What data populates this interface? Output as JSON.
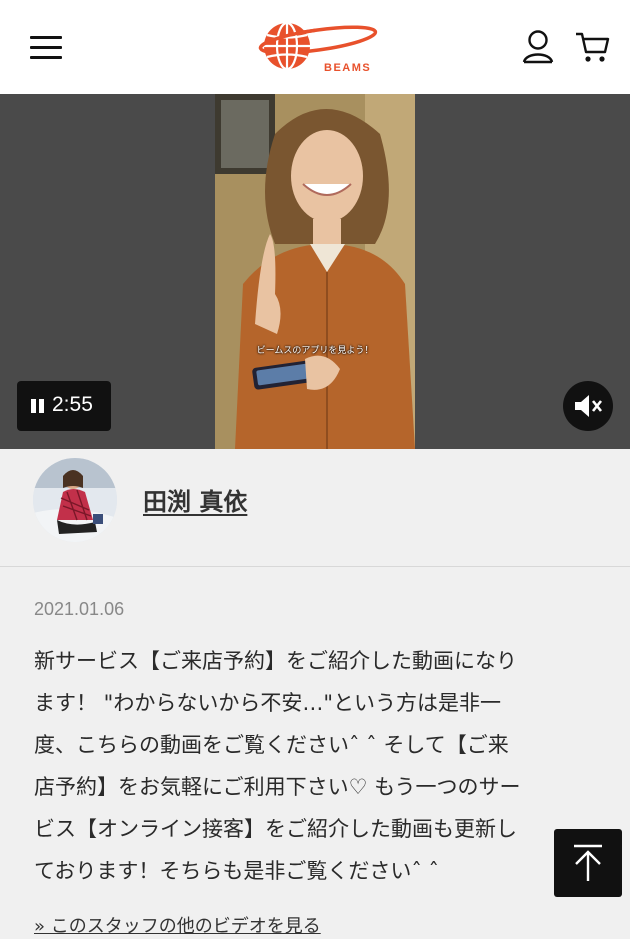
{
  "header": {
    "brand": "BEAMS",
    "icons": {
      "menu": "hamburger-menu-icon",
      "account": "user-icon",
      "cart": "cart-icon"
    },
    "brand_color": "#e8512c"
  },
  "video": {
    "subtitle": "ビームスのアプリを見よう！",
    "time": "2:55",
    "state": "playing",
    "muted": true
  },
  "staff": {
    "name": "田渕 真依"
  },
  "post": {
    "date": "2021.01.06",
    "lines": [
      "新サービス【ご来店予約】をご紹介した動画になり",
      "ます！ \"わからないから不安…\"という方は是非一",
      "度、こちらの動画をご覧くださいˆ ˆ そして【ご来",
      "店予約】をお気軽にご利用下さい♡ もう一つのサー",
      "ビス【オンライン接客】をご紹介した動画も更新し",
      "ております！そちらも是非ご覧くださいˆ ˆ"
    ],
    "more_link": "» このスタッフの他のビデオを見る"
  }
}
